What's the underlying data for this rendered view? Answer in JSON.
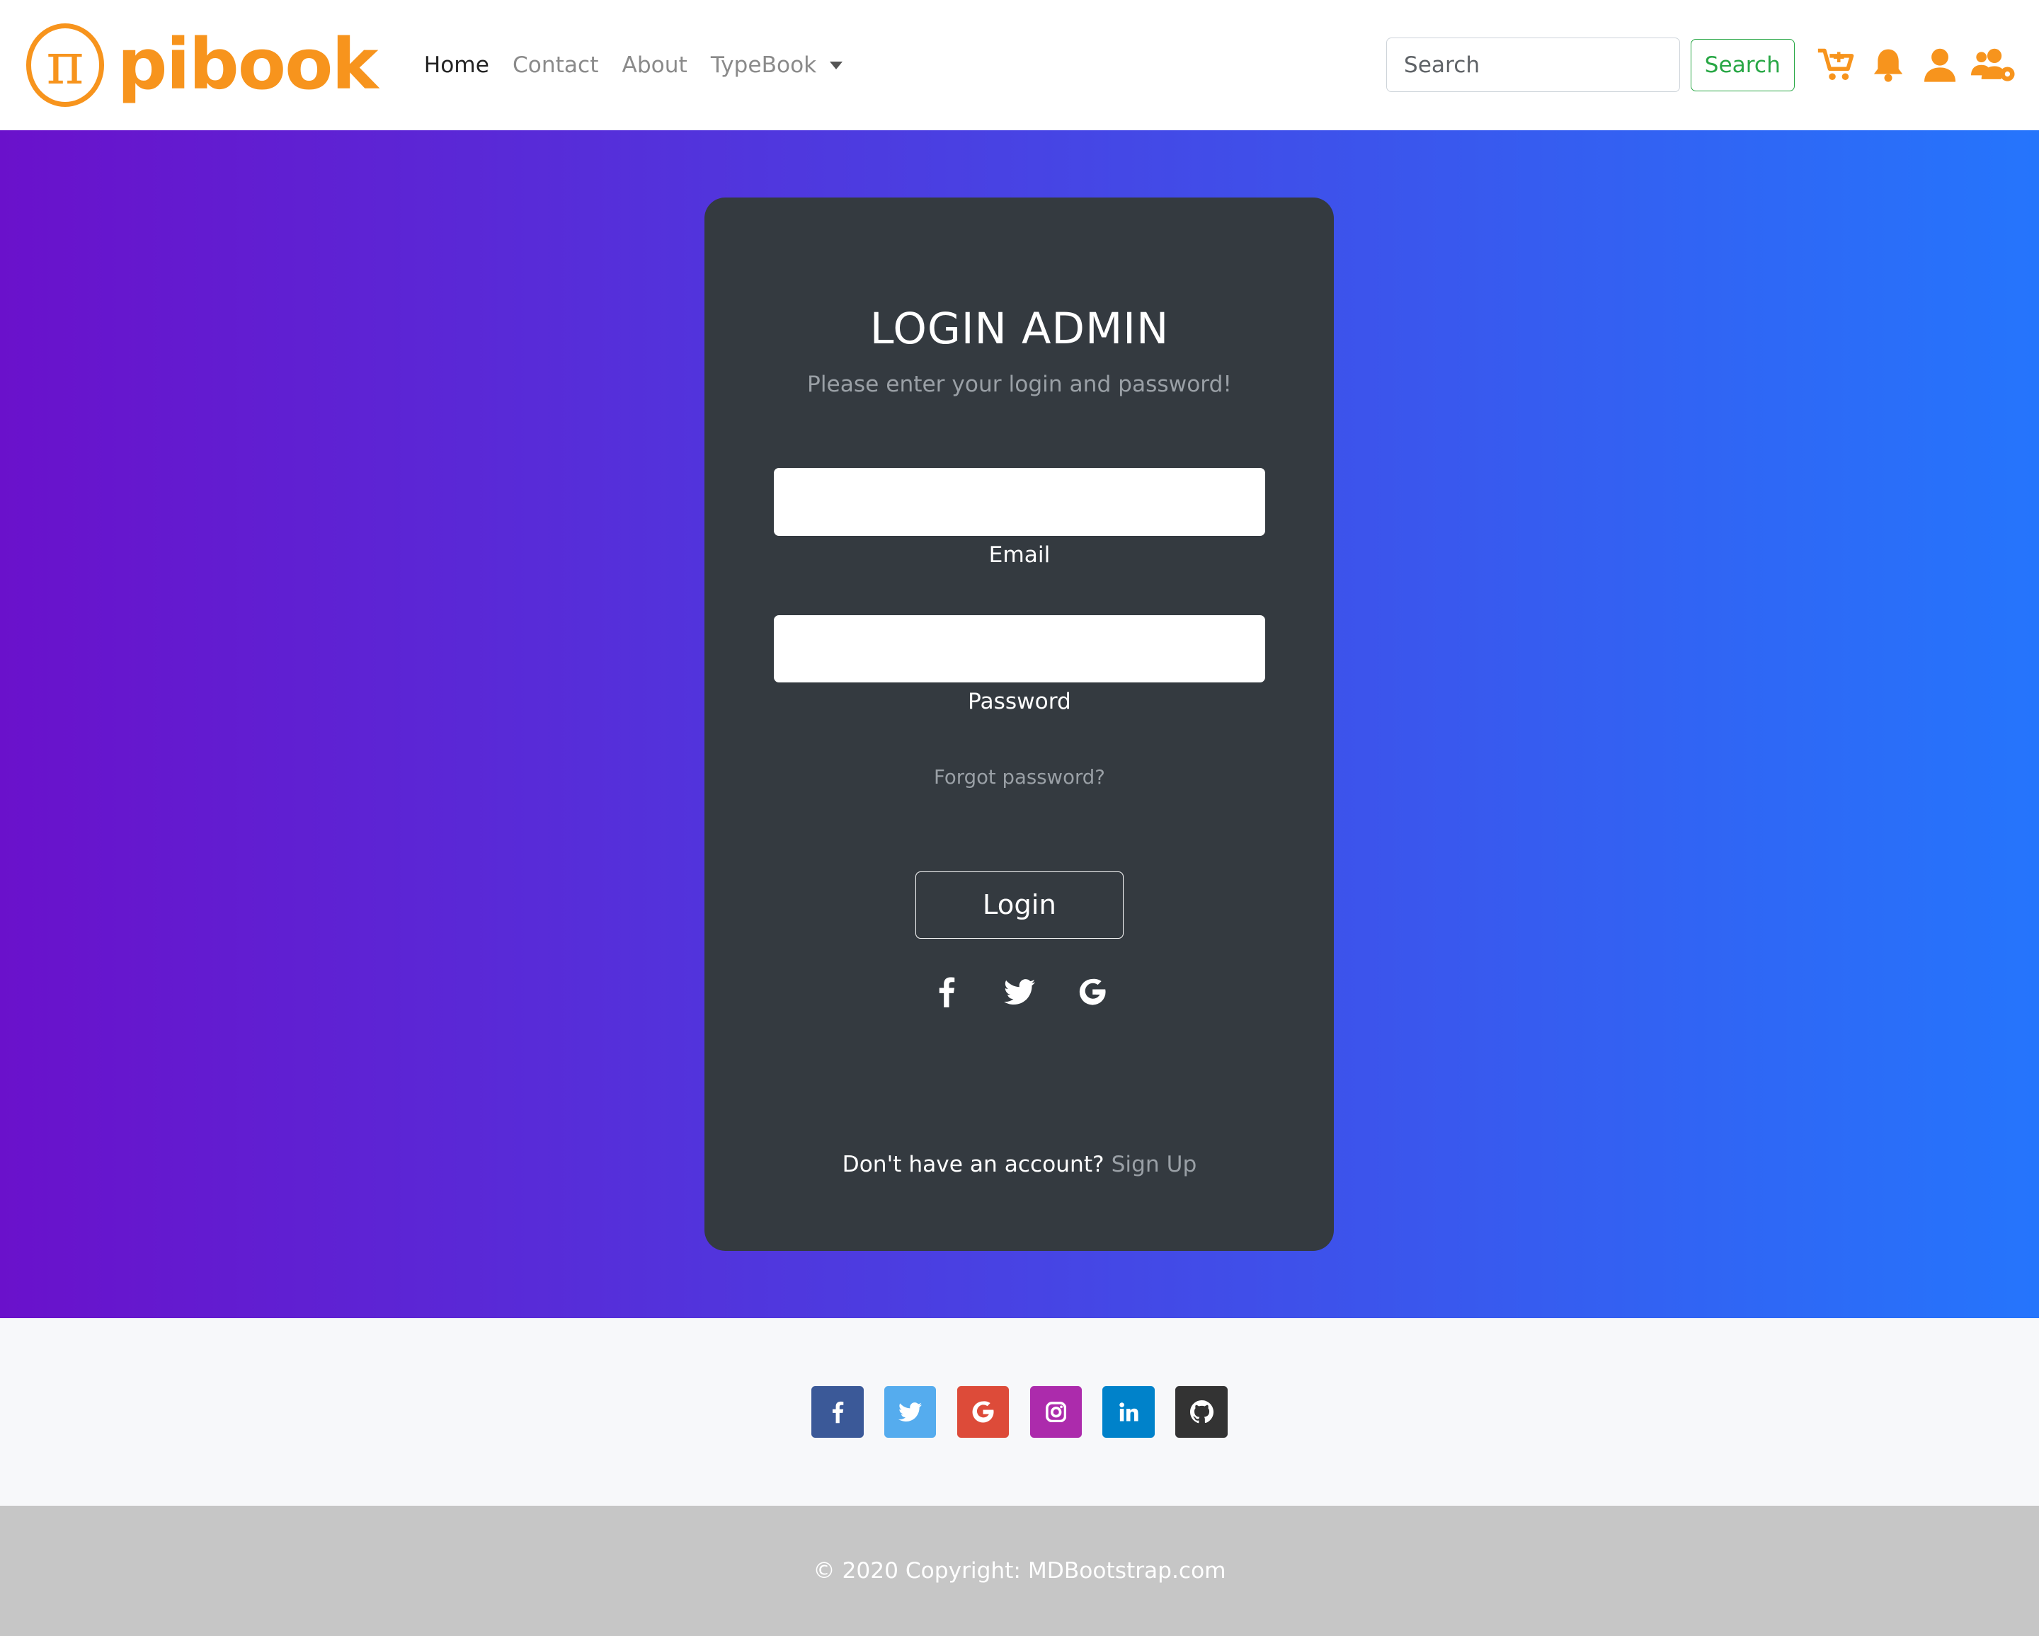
{
  "brand": {
    "logo_symbol": "π",
    "logo_text": "pibook",
    "color": "#f7941d"
  },
  "nav": {
    "links": [
      {
        "label": "Home",
        "active": true
      },
      {
        "label": "Contact",
        "active": false
      },
      {
        "label": "About",
        "active": false
      },
      {
        "label": "TypeBook",
        "active": false,
        "dropdown": true
      }
    ],
    "search_placeholder": "Search",
    "search_button": "Search",
    "icons": [
      "cart-plus-icon",
      "bell-icon",
      "user-icon",
      "users-cog-icon"
    ]
  },
  "hero": {
    "gradient_start": "#6a11cb",
    "gradient_end": "#2575fc"
  },
  "login": {
    "title": "LOGIN ADMIN",
    "subtitle": "Please enter your login and password!",
    "email_label": "Email",
    "password_label": "Password",
    "forgot": "Forgot password?",
    "button": "Login",
    "socials": [
      "facebook-icon",
      "twitter-icon",
      "google-icon"
    ],
    "signup_prompt": "Don't have an account?",
    "signup_link": "Sign Up"
  },
  "footer": {
    "socials": [
      {
        "name": "facebook-icon",
        "color": "#3b5998"
      },
      {
        "name": "twitter-icon",
        "color": "#55acee"
      },
      {
        "name": "google-icon",
        "color": "#dd4b39"
      },
      {
        "name": "instagram-icon",
        "color": "#ac2bac"
      },
      {
        "name": "linkedin-icon",
        "color": "#0082ca"
      },
      {
        "name": "github-icon",
        "color": "#333333"
      }
    ],
    "copyright": "© 2020 Copyright: MDBootstrap.com"
  }
}
